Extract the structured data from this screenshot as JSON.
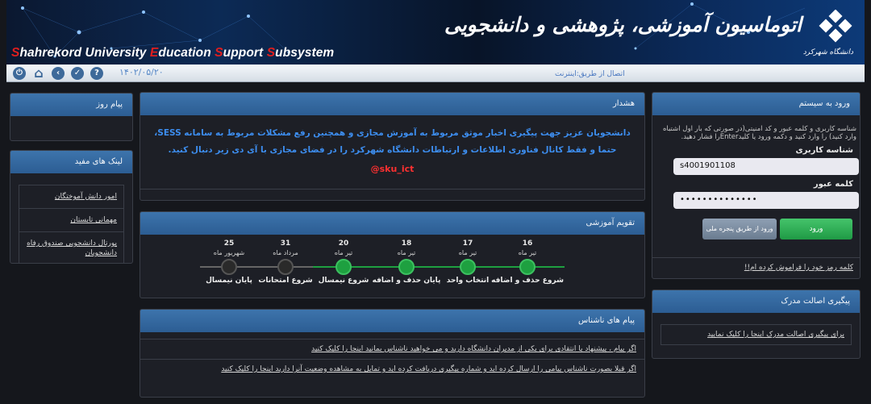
{
  "banner": {
    "english_title": {
      "parts": [
        {
          "cap": "S",
          "rest": "hahrekord University "
        },
        {
          "cap": "E",
          "rest": "ducation "
        },
        {
          "cap": "S",
          "rest": "upport "
        },
        {
          "cap": "S",
          "rest": "ubsystem"
        }
      ]
    },
    "persian_title": "اتوماسیون آموزشی، پژوهشی و دانشجویی",
    "logo_caption": "دانشگاه شهرکرد"
  },
  "toolbar": {
    "date": "۱۴۰۲/۰۵/۲۰",
    "connection": "اتصال از طریق:اینترنت",
    "icons": [
      "power-icon",
      "home-icon",
      "back-icon",
      "check-icon",
      "help-icon"
    ]
  },
  "daily_message": {
    "title": "پیام روز"
  },
  "useful_links": {
    "title": "لینک های مفید",
    "items": [
      "امور دانش آموختگان",
      "مهمانی تابستان",
      "پورتال دانشجویی صندوق رفاه دانشجویان"
    ]
  },
  "alert": {
    "title": "هشدار",
    "text": "دانشجویان عزیز جهت پیگیری اخبار موثق مربوط به آموزش مجازی و همچنین رفع مشکلات مربوط به سامانه SESS، حتما و فقط کانال فناوری اطلاعات و ارتباطات دانشگاه شهرکرد را در فضای مجازی با آی دی زیر دنبال کنید.",
    "handle": "@sku_ict"
  },
  "calendar": {
    "title": "تقویم آموزشی",
    "events": [
      {
        "day": "16",
        "month": "تیر ماه",
        "label": "شروع حذف و اضافه",
        "done": true
      },
      {
        "day": "17",
        "month": "تیر ماه",
        "label": "انتخاب واحد",
        "done": true
      },
      {
        "day": "18",
        "month": "تیر ماه",
        "label": "پایان حذف و اضافه",
        "done": true
      },
      {
        "day": "20",
        "month": "تیر ماه",
        "label": "شروع نیمسال",
        "done": true
      },
      {
        "day": "31",
        "month": "مرداد ماه",
        "label": "شروع امتحانات",
        "done": false
      },
      {
        "day": "25",
        "month": "شهریور ماه",
        "label": "پایان نیمسال",
        "done": false
      }
    ]
  },
  "anonymous": {
    "title": "پیام های ناشناس",
    "items": [
      "اگر پیام ، پیشنهاد یا انتقادی برای یکی از مدیران دانشگاه دارید و می خواهید ناشناس بمانید اینجا را کلیک کنید",
      "اگر قبلا بصورت ناشناس پیامی را ارسال کرده اید و شماره پیگیری دریافت کرده اید و تمایل به مشاهده وضعیت آنرا دارید اینجا را کلیک کنید"
    ]
  },
  "login": {
    "title": "ورود به سیستم",
    "info": "شناسه کاربری و کلمه عبور و کد امنیتی(در صورتی که بار اول اشتباه وارد کنید) را وارد کنید و دکمه ورود یا کلیدEnterرا فشار دهید.",
    "username_label": "شناسه کاربری",
    "username_value": "s4001901108",
    "password_label": "کلمه عبور",
    "password_value": "••••••••••••••",
    "login_button": "ورود",
    "national_button": "ورود از طریق پنجره ملی",
    "forgot": "کلمه رمز خود را فراموش کرده ام!!"
  },
  "certificate": {
    "title": "پیگیری اصالت مدرک",
    "link": "برای پیگیری اصالت مدرک اینجا را کلیک نمایید"
  },
  "colors": {
    "panel_header": "#2f6399",
    "alert_text": "#3d8ef0",
    "handle": "#ff3030",
    "timeline_done": "#1ea040",
    "timeline_pending": "#2a2a2a"
  }
}
